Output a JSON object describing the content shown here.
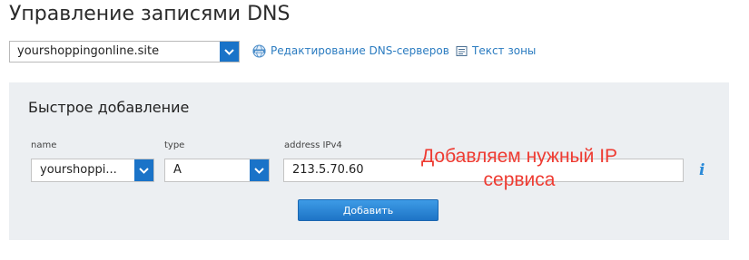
{
  "page": {
    "title": "Управление записями DNS"
  },
  "toolbar": {
    "domain_selected": "yourshoppingonline.site",
    "link_dns_servers": "Редактирование DNS-серверов",
    "link_zone_text": "Текст зоны"
  },
  "quick_add": {
    "title": "Быстрое добавление",
    "name_label": "name",
    "name_value": "yourshoppi...",
    "type_label": "type",
    "type_value": "A",
    "address_label": "address IPv4",
    "address_value": "213.5.70.60",
    "add_button": "Добавить",
    "info_icon_glyph": "i"
  },
  "annotation": {
    "text": "Добавляем нужный IP сервиса",
    "color": "#ee3b32"
  },
  "colors": {
    "accent": "#1a73c8",
    "link": "#2a7bc0",
    "panel_bg": "#eceff2"
  },
  "icons": {
    "dropdown": "chevron-down-icon",
    "dns_servers": "www-globe-icon",
    "zone_text": "document-icon",
    "info": "info-icon"
  }
}
